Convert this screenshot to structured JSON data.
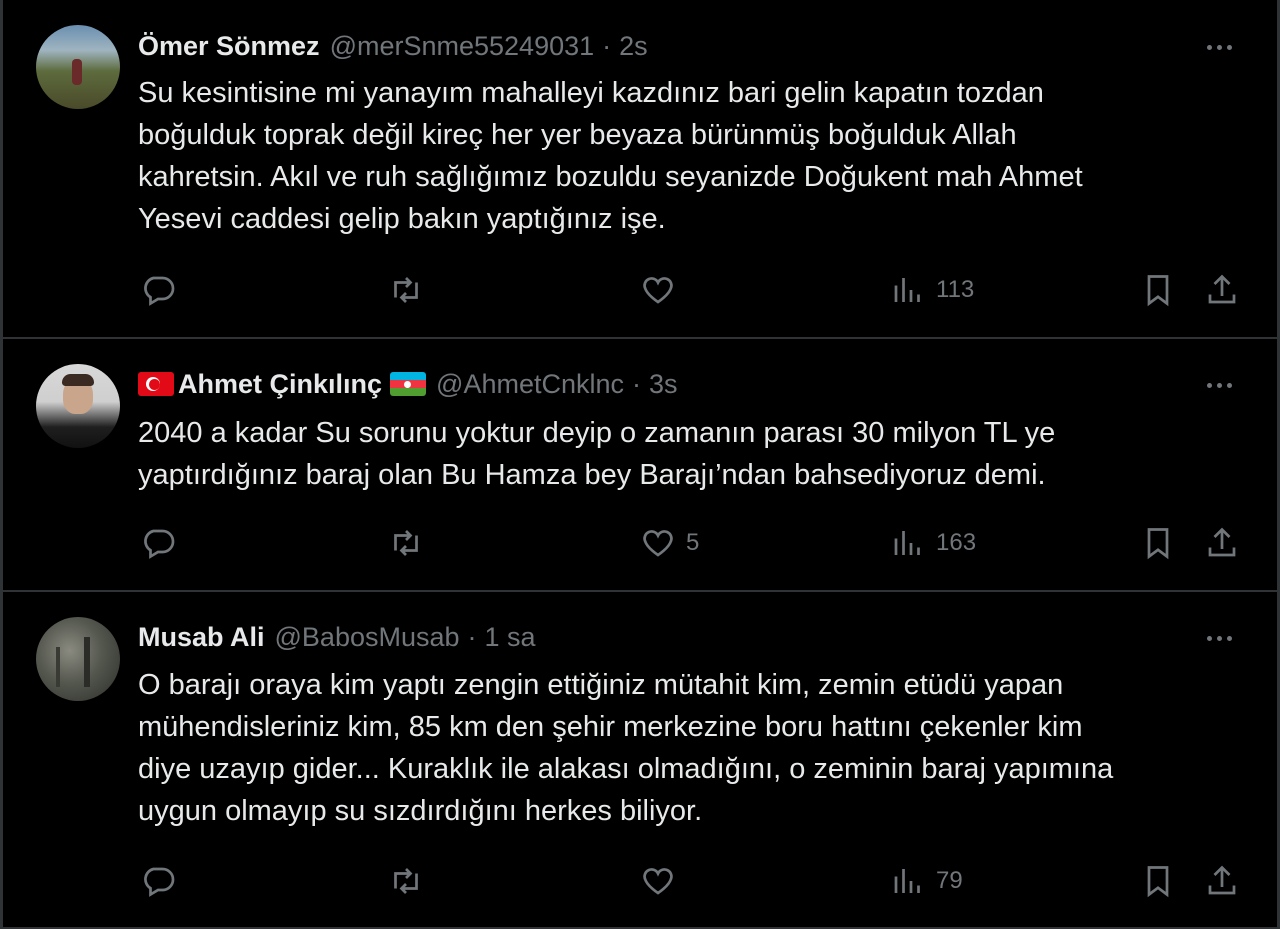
{
  "tweets": [
    {
      "name": "Ömer Sönmez",
      "handle": "@merSnme55249031",
      "separator": "·",
      "time": "2s",
      "text": [
        "Su kesintisine mi yanayım mahalleyi kazdınız bari gelin kapatın tozdan",
        "boğulduk toprak değil kireç her yer beyaza bürünmüş boğulduk Allah",
        "kahretsin. Akıl ve ruh sağlığımız bozuldu seyanizde Doğukent mah Ahmet",
        "Yesevi caddesi gelip bakın yaptığınız işe."
      ],
      "likes": "",
      "views": "113"
    },
    {
      "name": "Ahmet Çinkılınç",
      "handle": "@AhmetCnklnc",
      "separator": "·",
      "time": "3s",
      "text": [
        "2040 a kadar Su sorunu yoktur deyip o zamanın parası 30 milyon TL ye",
        "yaptırdığınız baraj olan Bu Hamza bey Barajı’ndan bahsediyoruz demi."
      ],
      "likes": "5",
      "views": "163"
    },
    {
      "name": "Musab Ali",
      "handle": "@BabosMusab",
      "separator": "·",
      "time": "1 sa",
      "text": [
        "O barajı oraya kim yaptı zengin ettiğiniz mütahit kim, zemin etüdü yapan",
        "mühendisleriniz kim, 85 km den şehir merkezine boru hattını çekenler kim",
        "diye uzayıp gider... Kuraklık ile alakası olmadığını, o  zeminin baraj yapımına",
        "uygun olmayıp su sızdırdığını herkes biliyor."
      ],
      "likes": "",
      "views": "79"
    }
  ],
  "colors": {
    "background": "#000000",
    "text": "#e7e9ea",
    "muted": "#71767b",
    "border": "#2f3336"
  },
  "icons": [
    "reply-icon",
    "retweet-icon",
    "like-icon",
    "views-icon",
    "bookmark-icon",
    "share-icon",
    "more-icon"
  ]
}
